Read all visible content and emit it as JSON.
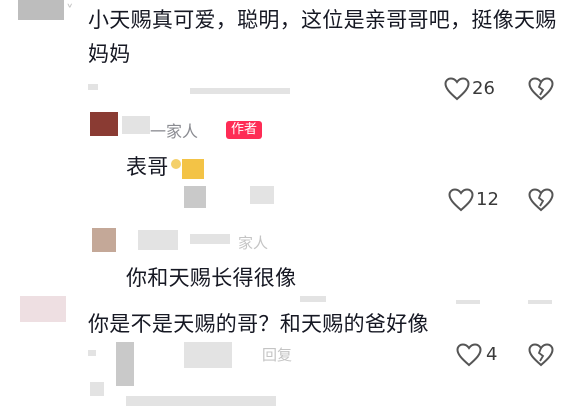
{
  "colors": {
    "author_badge": "#fe2c55",
    "text": "#161823",
    "icon": "#555555"
  },
  "comments": [
    {
      "text_line1": "小天赐真可爱，聪明，这位是亲哥哥吧，挺像天赐",
      "text_line2": "妈妈",
      "likes": "26"
    },
    {
      "username_suffix": "一家人",
      "badge": "作者",
      "text": "表哥",
      "likes": "12"
    },
    {
      "username_suffix": "家人",
      "text": "你和天赐长得很像"
    },
    {
      "text": "你是不是天赐的哥？和天赐的爸好像",
      "reply_label": "回复",
      "likes": "4"
    }
  ],
  "icons": {
    "like": "heart-icon",
    "dislike": "broken-heart-icon",
    "emoji": "emoji-icon"
  }
}
